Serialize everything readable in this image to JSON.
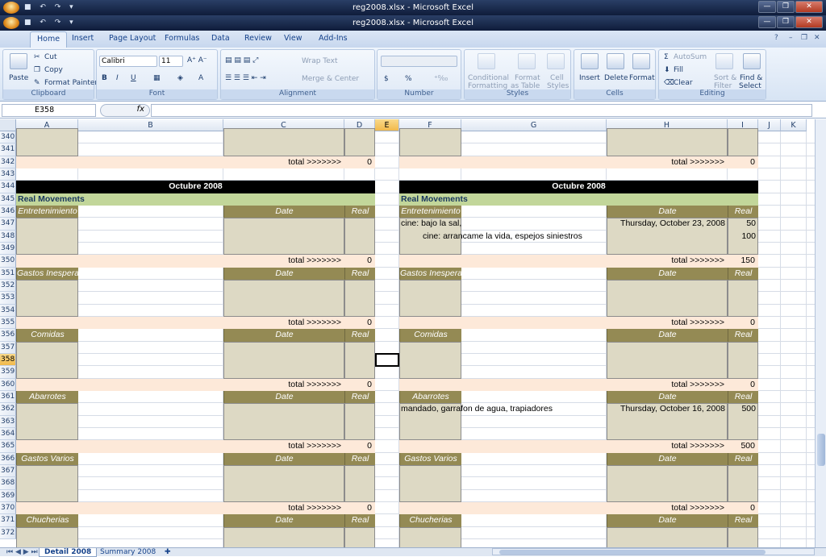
{
  "window": {
    "title_back": "reg2008.xlsx - Microsoft Excel",
    "title_front": "reg2008.xlsx - Microsoft Excel"
  },
  "ribbon_tabs": [
    "Home",
    "Insert",
    "Page Layout",
    "Formulas",
    "Data",
    "Review",
    "View",
    "Add-Ins"
  ],
  "clipboard": {
    "paste": "Paste",
    "cut": "Cut",
    "copy": "Copy",
    "format_painter": "Format Painter",
    "label": "Clipboard"
  },
  "font": {
    "name": "Calibri",
    "size": "11",
    "label": "Font"
  },
  "alignment": {
    "wrap": "Wrap Text",
    "merge": "Merge & Center",
    "label": "Alignment"
  },
  "number": {
    "currency": "$",
    "percent": "%",
    "label": "Number"
  },
  "styles": {
    "conditional": "Conditional",
    "formatting": "Formatting",
    "format_as": "Format",
    "as_table": "as Table",
    "cell": "Cell",
    "cell_styles": "Styles",
    "label": "Styles"
  },
  "cells": {
    "insert": "Insert",
    "delete": "Delete",
    "format": "Format",
    "label": "Cells"
  },
  "editing": {
    "autosum": "AutoSum",
    "fill": "Fill",
    "clear": "Clear",
    "sort": "Sort &",
    "filter": "Filter",
    "find": "Find &",
    "select": "Select",
    "label": "Editing"
  },
  "formula_bar": {
    "name_box": "E358",
    "fx": "fx",
    "formula": ""
  },
  "columns": [
    "A",
    "B",
    "C",
    "D",
    "E",
    "F",
    "G",
    "H",
    "I",
    "J",
    "K"
  ],
  "rows": [
    "340",
    "341",
    "342",
    "343",
    "344",
    "345",
    "346",
    "347",
    "348",
    "349",
    "350",
    "351",
    "352",
    "353",
    "354",
    "355",
    "356",
    "357",
    "358",
    "359",
    "360",
    "361",
    "362",
    "363",
    "364",
    "365",
    "366",
    "367",
    "368",
    "369",
    "370",
    "371",
    "372"
  ],
  "selected_row": "358",
  "selected_col": "E",
  "sheet_text": {
    "month": "Octubre 2008",
    "real_movements": "Real Movements",
    "date": "Date",
    "real": "Real",
    "total_label": "total >>>>>>>"
  },
  "categories": [
    "Entretenimiento",
    "Gastos Inesperados",
    "Comidas",
    "Abarrotes",
    "Gastos Varios",
    "Chucherias"
  ],
  "left_totals": {
    "prev": "0",
    "entretenimiento": "0",
    "inesperados": "0",
    "comidas": "0",
    "abarrotes": "0",
    "varios": "0"
  },
  "right_totals": {
    "prev": "0",
    "entretenimiento": "150",
    "inesperados": "0",
    "comidas": "0",
    "abarrotes": "500",
    "varios": "0"
  },
  "entries": {
    "e1_desc": "cine: bajo la sal,",
    "e1_date": "Thursday, October 23, 2008",
    "e1_real": "50",
    "e2_desc": "cine: arrancame la vida, espejos siniestros",
    "e2_real": "100",
    "a1_desc": "mandado, garrafon de agua, trapiadores",
    "a1_date": "Thursday, October 16, 2008",
    "a1_real": "500"
  },
  "sheets": [
    "Detail 2008",
    "Summary 2008"
  ]
}
